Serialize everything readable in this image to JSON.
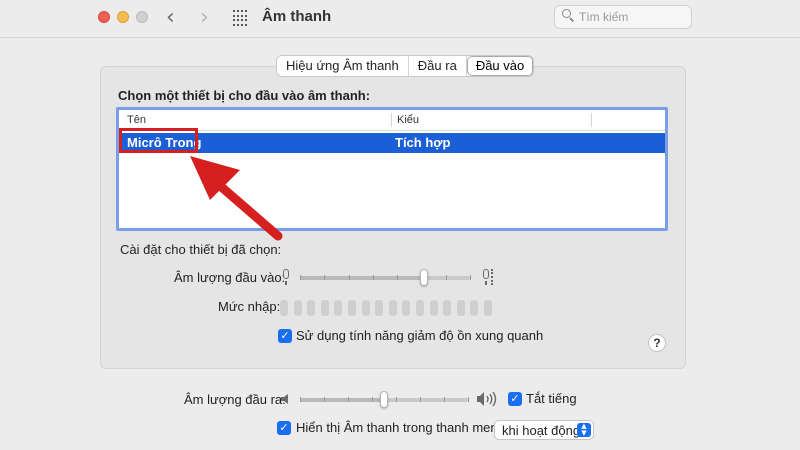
{
  "window": {
    "title": "Âm thanh",
    "search_placeholder": "Tìm kiếm"
  },
  "tabs": [
    {
      "label": "Hiệu ứng Âm thanh",
      "active": false
    },
    {
      "label": "Đầu ra",
      "active": false
    },
    {
      "label": "Đầu vào",
      "active": true
    }
  ],
  "input_section": {
    "heading": "Chọn một thiết bị cho đầu vào âm thanh:",
    "columns": [
      "Tên",
      "Kiểu"
    ],
    "devices": [
      {
        "name": "Micrô Trong",
        "type": "Tích hợp",
        "selected": true
      }
    ]
  },
  "selected_settings": {
    "heading": "Cài đặt cho thiết bị đã chọn:",
    "input_volume_label": "Âm lượng đầu vào:",
    "input_volume_fraction": 0.73,
    "input_level_label": "Mức nhập:",
    "input_level_active_cells": 0,
    "noise_reduction_label": "Sử dụng tính năng giảm độ ồn xung quanh",
    "noise_reduction_checked": true
  },
  "output": {
    "volume_label": "Âm lượng đầu ra:",
    "volume_fraction": 0.5,
    "mute_label": "Tắt tiếng",
    "mute_checked": true,
    "show_in_menu_label": "Hiển thị Âm thanh trong thanh menu",
    "show_in_menu_checked": true,
    "menu_visibility_value": "khi hoạt động"
  },
  "colors": {
    "selection": "#1a5fd6",
    "accent": "#1a6ff0",
    "annotation": "#d62020"
  },
  "icons": [
    "search-icon",
    "grid-icon",
    "microphone-icon",
    "speaker-low-icon",
    "speaker-high-icon",
    "help-icon"
  ]
}
